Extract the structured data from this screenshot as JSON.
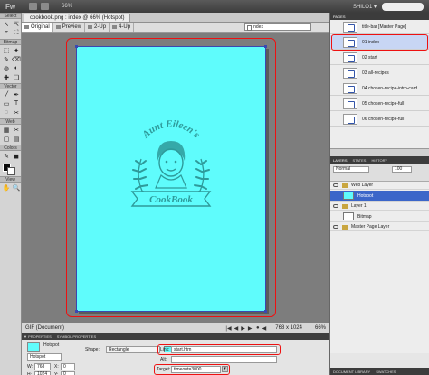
{
  "app": {
    "logo": "Fw",
    "zoom": "66%",
    "workspace": "SHILO1 ▾"
  },
  "tools": {
    "sections": [
      "Select",
      "Bitmap",
      "Vector",
      "Web",
      "Colors",
      "View"
    ],
    "select": [
      "↖",
      "⇱",
      "⌗",
      "⛶"
    ],
    "bitmap": [
      "⬚",
      "✦",
      "✎",
      "⌫",
      "◍",
      "◐",
      "✚",
      "❏"
    ],
    "vector": [
      "╱",
      "✒",
      "▭",
      "T",
      "◌",
      "✂"
    ],
    "web": [
      "▦",
      "✂",
      "▢",
      "▤"
    ],
    "colors": [
      "✎",
      "◼"
    ],
    "view": [
      "✋",
      "🔍"
    ]
  },
  "document": {
    "tab_title": "cookbook.png : index @ 66% (Hotspot)",
    "views": [
      "Original",
      "Preview",
      "2-Up",
      "4-Up"
    ],
    "page_selector": "index",
    "status_left": "GIF (Document)",
    "status_dims": "768 x 1024",
    "status_zoom": "66%",
    "status_vcr": [
      "|◀",
      "◀",
      "▶",
      "▶|",
      "●",
      "◀"
    ]
  },
  "artwork": {
    "arc_text": "Aunt Eileen's",
    "ribbon_text": "CookBook"
  },
  "properties": {
    "tabs": [
      "▼ PROPERTIES",
      "SYMBOL PROPERTIES"
    ],
    "type": "Hotspot",
    "name": "Hotspot",
    "shape_label": "Shape:",
    "shape_value": "Rectangle",
    "link_label": "Link:",
    "link_value": "start.htm",
    "alt_label": "Alt:",
    "alt_value": "",
    "target_label": "Target:",
    "target_value": "timeout=3000",
    "w_label": "W:",
    "w_value": "768",
    "x_label": "X:",
    "x_value": "0",
    "h_label": "H:",
    "h_value": "1024",
    "y_label": "Y:",
    "y_value": "0"
  },
  "pages_panel": {
    "tabs": [
      "PAGES"
    ],
    "pages": [
      {
        "name": "title-bar [Master Page]",
        "selected": false
      },
      {
        "name": "01  index",
        "selected": true
      },
      {
        "name": "02  start",
        "selected": false
      },
      {
        "name": "03  all-recipes",
        "selected": false
      },
      {
        "name": "04  chosen-recipe-intro-card",
        "selected": false
      },
      {
        "name": "05  chosen-recipe-full",
        "selected": false
      },
      {
        "name": "06  chosen-recipe-full",
        "selected": false
      }
    ]
  },
  "layers_panel": {
    "tabs": [
      "LAYERS",
      "STATES",
      "HISTORY"
    ],
    "blend": "Normal",
    "opacity": "100",
    "layers": [
      {
        "name": "Web Layer",
        "kind": "folder",
        "selected": false
      },
      {
        "name": "Hotspot",
        "kind": "object",
        "selected": true
      },
      {
        "name": "Layer 1",
        "kind": "folder",
        "selected": false
      },
      {
        "name": "Bitmap",
        "kind": "object",
        "selected": false
      },
      {
        "name": "Master Page Layer",
        "kind": "folder",
        "selected": false
      }
    ],
    "footer_tabs": [
      "DOCUMENT LIBRARY",
      "SWATCHES"
    ]
  },
  "colors": {
    "accent_cyan": "#5ffcfc",
    "highlight_red": "#e11111",
    "artwork_teal": "#2e9a9a",
    "selection_blue": "#3b66c9"
  }
}
